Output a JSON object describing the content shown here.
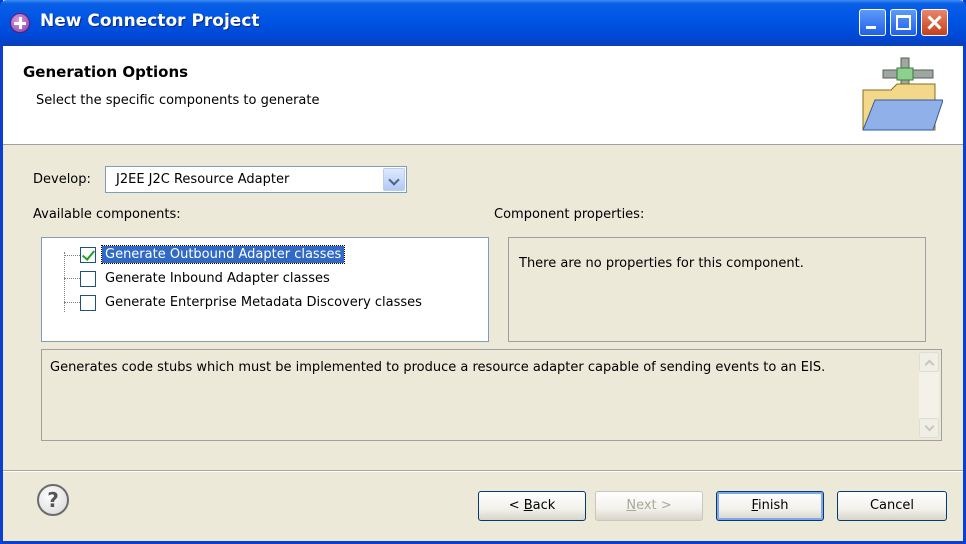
{
  "window": {
    "title": "New Connector Project"
  },
  "header": {
    "title": "Generation Options",
    "description": "Select the specific components to generate"
  },
  "develop": {
    "label": "Develop:",
    "selected": "J2EE J2C Resource Adapter"
  },
  "components": {
    "label": "Available components:",
    "items": [
      {
        "label": "Generate Outbound Adapter classes",
        "checked": true
      },
      {
        "label": "Generate Inbound Adapter classes",
        "checked": false
      },
      {
        "label": "Generate Enterprise Metadata Discovery classes",
        "checked": false
      }
    ]
  },
  "properties": {
    "label": "Component properties:",
    "message": "There are no properties for this component."
  },
  "description": "Generates code stubs which must be implemented to produce a resource adapter capable of sending events to an EIS.",
  "buttons": {
    "back_pre": "< ",
    "back_key": "B",
    "back_post": "ack",
    "next_pre": "",
    "next_key": "N",
    "next_post": "ext >",
    "finish_key": "F",
    "finish_post": "inish",
    "cancel": "Cancel"
  },
  "icons": {
    "app": "connector-project-icon",
    "banner": "open-folder-connector-icon",
    "help": "help-icon"
  }
}
